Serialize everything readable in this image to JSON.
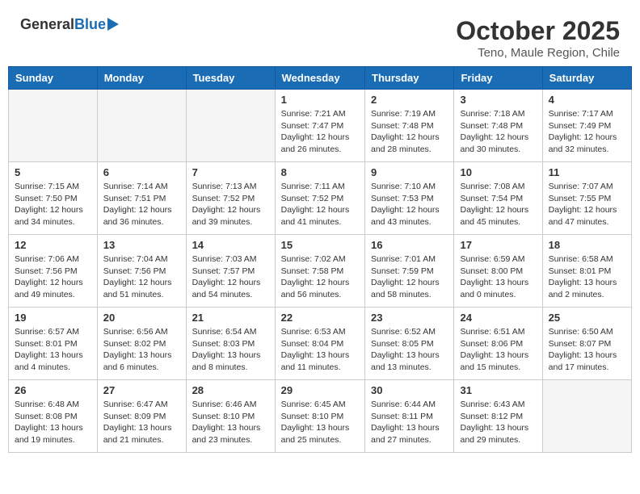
{
  "header": {
    "logo_general": "General",
    "logo_blue": "Blue",
    "month_title": "October 2025",
    "location": "Teno, Maule Region, Chile"
  },
  "days_of_week": [
    "Sunday",
    "Monday",
    "Tuesday",
    "Wednesday",
    "Thursday",
    "Friday",
    "Saturday"
  ],
  "weeks": [
    [
      {
        "day": "",
        "empty": true
      },
      {
        "day": "",
        "empty": true
      },
      {
        "day": "",
        "empty": true
      },
      {
        "day": "1",
        "sunrise": "7:21 AM",
        "sunset": "7:47 PM",
        "daylight": "12 hours and 26 minutes."
      },
      {
        "day": "2",
        "sunrise": "7:19 AM",
        "sunset": "7:48 PM",
        "daylight": "12 hours and 28 minutes."
      },
      {
        "day": "3",
        "sunrise": "7:18 AM",
        "sunset": "7:48 PM",
        "daylight": "12 hours and 30 minutes."
      },
      {
        "day": "4",
        "sunrise": "7:17 AM",
        "sunset": "7:49 PM",
        "daylight": "12 hours and 32 minutes."
      }
    ],
    [
      {
        "day": "5",
        "sunrise": "7:15 AM",
        "sunset": "7:50 PM",
        "daylight": "12 hours and 34 minutes."
      },
      {
        "day": "6",
        "sunrise": "7:14 AM",
        "sunset": "7:51 PM",
        "daylight": "12 hours and 36 minutes."
      },
      {
        "day": "7",
        "sunrise": "7:13 AM",
        "sunset": "7:52 PM",
        "daylight": "12 hours and 39 minutes."
      },
      {
        "day": "8",
        "sunrise": "7:11 AM",
        "sunset": "7:52 PM",
        "daylight": "12 hours and 41 minutes."
      },
      {
        "day": "9",
        "sunrise": "7:10 AM",
        "sunset": "7:53 PM",
        "daylight": "12 hours and 43 minutes."
      },
      {
        "day": "10",
        "sunrise": "7:08 AM",
        "sunset": "7:54 PM",
        "daylight": "12 hours and 45 minutes."
      },
      {
        "day": "11",
        "sunrise": "7:07 AM",
        "sunset": "7:55 PM",
        "daylight": "12 hours and 47 minutes."
      }
    ],
    [
      {
        "day": "12",
        "sunrise": "7:06 AM",
        "sunset": "7:56 PM",
        "daylight": "12 hours and 49 minutes."
      },
      {
        "day": "13",
        "sunrise": "7:04 AM",
        "sunset": "7:56 PM",
        "daylight": "12 hours and 51 minutes."
      },
      {
        "day": "14",
        "sunrise": "7:03 AM",
        "sunset": "7:57 PM",
        "daylight": "12 hours and 54 minutes."
      },
      {
        "day": "15",
        "sunrise": "7:02 AM",
        "sunset": "7:58 PM",
        "daylight": "12 hours and 56 minutes."
      },
      {
        "day": "16",
        "sunrise": "7:01 AM",
        "sunset": "7:59 PM",
        "daylight": "12 hours and 58 minutes."
      },
      {
        "day": "17",
        "sunrise": "6:59 AM",
        "sunset": "8:00 PM",
        "daylight": "13 hours and 0 minutes."
      },
      {
        "day": "18",
        "sunrise": "6:58 AM",
        "sunset": "8:01 PM",
        "daylight": "13 hours and 2 minutes."
      }
    ],
    [
      {
        "day": "19",
        "sunrise": "6:57 AM",
        "sunset": "8:01 PM",
        "daylight": "13 hours and 4 minutes."
      },
      {
        "day": "20",
        "sunrise": "6:56 AM",
        "sunset": "8:02 PM",
        "daylight": "13 hours and 6 minutes."
      },
      {
        "day": "21",
        "sunrise": "6:54 AM",
        "sunset": "8:03 PM",
        "daylight": "13 hours and 8 minutes."
      },
      {
        "day": "22",
        "sunrise": "6:53 AM",
        "sunset": "8:04 PM",
        "daylight": "13 hours and 11 minutes."
      },
      {
        "day": "23",
        "sunrise": "6:52 AM",
        "sunset": "8:05 PM",
        "daylight": "13 hours and 13 minutes."
      },
      {
        "day": "24",
        "sunrise": "6:51 AM",
        "sunset": "8:06 PM",
        "daylight": "13 hours and 15 minutes."
      },
      {
        "day": "25",
        "sunrise": "6:50 AM",
        "sunset": "8:07 PM",
        "daylight": "13 hours and 17 minutes."
      }
    ],
    [
      {
        "day": "26",
        "sunrise": "6:48 AM",
        "sunset": "8:08 PM",
        "daylight": "13 hours and 19 minutes."
      },
      {
        "day": "27",
        "sunrise": "6:47 AM",
        "sunset": "8:09 PM",
        "daylight": "13 hours and 21 minutes."
      },
      {
        "day": "28",
        "sunrise": "6:46 AM",
        "sunset": "8:10 PM",
        "daylight": "13 hours and 23 minutes."
      },
      {
        "day": "29",
        "sunrise": "6:45 AM",
        "sunset": "8:10 PM",
        "daylight": "13 hours and 25 minutes."
      },
      {
        "day": "30",
        "sunrise": "6:44 AM",
        "sunset": "8:11 PM",
        "daylight": "13 hours and 27 minutes."
      },
      {
        "day": "31",
        "sunrise": "6:43 AM",
        "sunset": "8:12 PM",
        "daylight": "13 hours and 29 minutes."
      },
      {
        "day": "",
        "empty": true
      }
    ]
  ],
  "labels": {
    "sunrise": "Sunrise:",
    "sunset": "Sunset:",
    "daylight": "Daylight hours"
  }
}
